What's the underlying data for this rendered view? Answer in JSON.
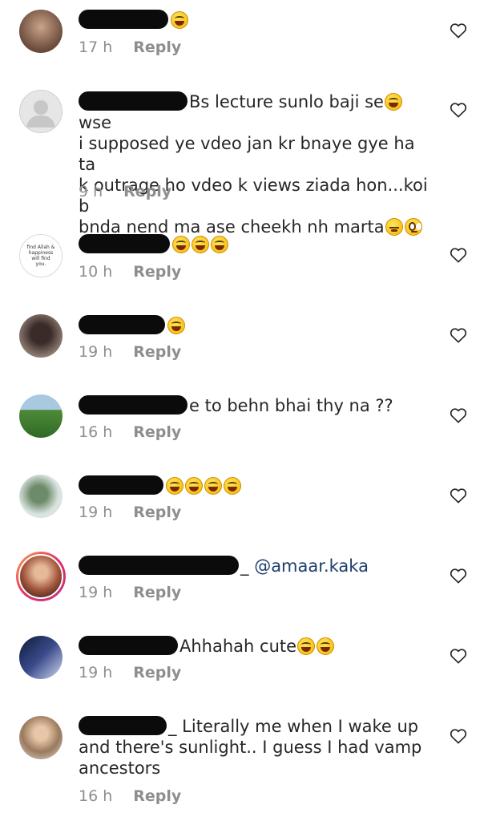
{
  "reply_label": "Reply",
  "comments": [
    {
      "time": "17 h",
      "text": ""
    },
    {
      "time": "9 h",
      "text": "Bs lecture sunlo baji se",
      "text2": "wse",
      "line2": "i supposed ye vdeo jan kr bnaye gye ha ta",
      "line3": "k outrage ho vdeo k views ziada hon...koi b",
      "line4": "bnda nend ma ase cheekh nh marta"
    },
    {
      "time": "10 h",
      "text": "",
      "avatar_text": "find Allah & happiness will find you."
    },
    {
      "time": "19 h",
      "text": ""
    },
    {
      "time": "16 h",
      "text": "e to behn bhai thy na ??"
    },
    {
      "time": "19 h",
      "text": ""
    },
    {
      "time": "19 h",
      "text": "_ ",
      "mention": "@amaar.kaka"
    },
    {
      "time": "19 h",
      "text": "Ahhahah cute"
    },
    {
      "time": "16 h",
      "text": "_ Literally me when I wake up",
      "line2": "and there's sunlight.. I guess I had vamp",
      "line3": "ancestors"
    }
  ],
  "icons": {
    "like": "heart-outline-icon",
    "emoji_laugh": "grinning-sweat-emoji",
    "emoji_think": "thinking-face-emoji",
    "emoji_roll": "eye-roll-emoji"
  },
  "colors": {
    "meta": "#8e8e8e",
    "text": "#262626",
    "mention": "#1c3e6e",
    "story_ring": "#e1306c"
  }
}
